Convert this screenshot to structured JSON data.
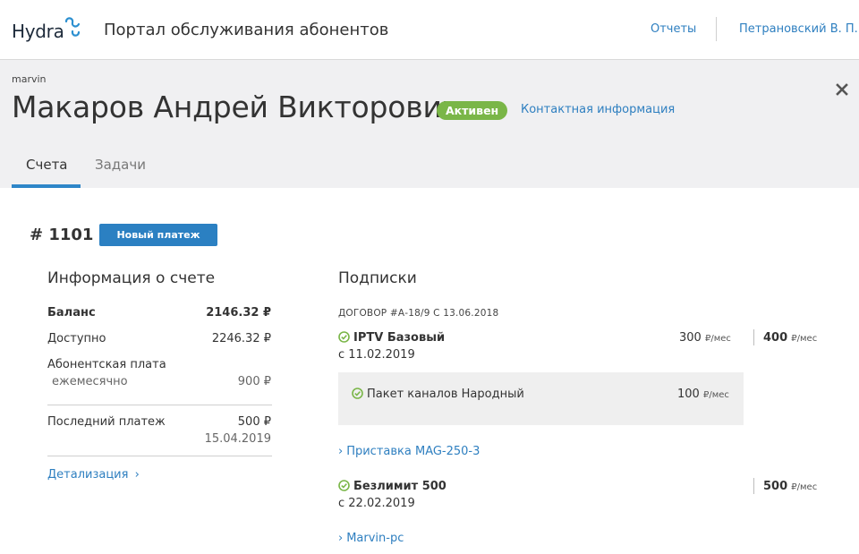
{
  "topbar": {
    "logo": "Hydra",
    "app_title": "Портал обслуживания абонентов",
    "reports_link": "Отчеты",
    "user_link": "Петрановский В. П."
  },
  "header": {
    "login": "marvin",
    "name": "Макаров Андрей Викторович",
    "status": "Активен",
    "contact_link": "Контактная информация",
    "tabs": [
      {
        "label": "Счета",
        "active": true
      },
      {
        "label": "Задачи",
        "active": false
      }
    ]
  },
  "account": {
    "number": "# 1101",
    "new_payment_button": "Новый платеж",
    "info": {
      "title": "Информация о счете",
      "balance_label": "Баланс",
      "balance_value": "2146.32 ₽",
      "available_label": "Доступно",
      "available_value": "2246.32 ₽",
      "fee_label": "Абонентская плата",
      "fee_period_label": "ежемесячно",
      "fee_value": "900 ₽",
      "last_payment_label": "Последний платеж",
      "last_payment_value": "500 ₽",
      "last_payment_date": "15.04.2019",
      "details_link": "Детализация"
    },
    "subscriptions": {
      "title": "Подписки",
      "contract": "ДОГОВОР #А-18/9  С 13.06.2018",
      "items": [
        {
          "name": "IPTV Базовый",
          "since": "с 11.02.2019",
          "price": "300",
          "unit": "₽/мес",
          "total": "400",
          "total_unit": "₽/мес",
          "package": {
            "name": "Пакет каналов Народный",
            "price": "100",
            "unit": "₽/мес"
          },
          "device_link": "Приставка MAG-250-3"
        },
        {
          "name": "Безлимит 500",
          "since": "с 22.02.2019",
          "total": "500",
          "total_unit": "₽/мес",
          "device_link": "Marvin-pc"
        }
      ]
    }
  },
  "colors": {
    "accent": "#2e7fc0",
    "status_green": "#7ab648",
    "header_bg": "#f0f0f2"
  },
  "icons": [
    "logo-mark-icon",
    "close-icon",
    "check-circle-icon",
    "chevron-right-icon"
  ]
}
